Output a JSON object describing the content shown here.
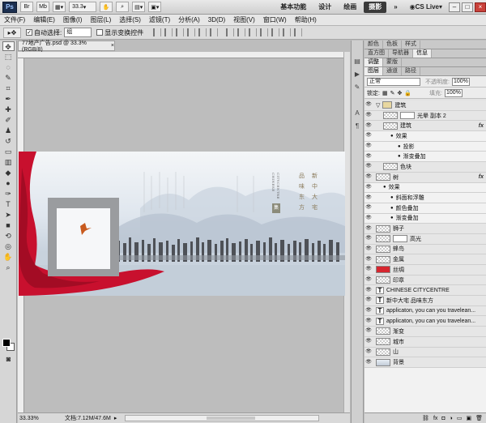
{
  "titlebar": {
    "app_logo": "Ps",
    "zoom": "33.3",
    "workspaces": [
      "基本功能",
      "设计",
      "绘画",
      "摄影"
    ],
    "active_workspace": "摄影",
    "cs_live": "CS Live"
  },
  "menu": [
    "文件(F)",
    "编辑(E)",
    "图像(I)",
    "图层(L)",
    "选择(S)",
    "滤镜(T)",
    "分析(A)",
    "3D(D)",
    "视图(V)",
    "窗口(W)",
    "帮助(H)"
  ],
  "options": {
    "auto_select_label": "自动选择:",
    "auto_select_value": "组",
    "show_transform_label": "显示变换控件"
  },
  "document": {
    "tab_title": "77地产广告.psd @ 33.3%(RGB/8)",
    "zoom": "33.33%",
    "doc_size": "文档:7.12M/47.6M"
  },
  "artwork_text": {
    "col1": [
      "新",
      "中",
      "大",
      "宅"
    ],
    "col2": [
      "品",
      "味",
      "东",
      "方"
    ],
    "en1": "CHINESE",
    "en2": "CITYCENTRE",
    "seal": "集"
  },
  "panels": {
    "top_tabs": [
      "颜色",
      "色板",
      "样式"
    ],
    "mid_tabs": [
      "直方图",
      "导航器",
      "信息"
    ],
    "adjust_tabs": [
      "调整",
      "蒙版"
    ],
    "layer_tabs": [
      "图层",
      "通道",
      "路径"
    ],
    "blend_mode": "正常",
    "opacity_label": "不透明度:",
    "opacity": "100%",
    "lock_label": "锁定:",
    "fill_label": "填充:",
    "fill": "100%"
  },
  "layers": [
    {
      "name": "建筑",
      "kind": "group",
      "indent": 0
    },
    {
      "name": "光晕 副本 2",
      "kind": "mask",
      "indent": 1
    },
    {
      "name": "建筑",
      "kind": "pixel",
      "indent": 1,
      "fx": true
    },
    {
      "name": "效果",
      "kind": "effect",
      "indent": 2
    },
    {
      "name": "投影",
      "kind": "effect",
      "indent": 3
    },
    {
      "name": "渐变叠加",
      "kind": "effect",
      "indent": 3
    },
    {
      "name": "色块",
      "kind": "pixel",
      "indent": 1
    },
    {
      "name": "树",
      "kind": "pixel",
      "indent": 0,
      "fx": true
    },
    {
      "name": "效果",
      "kind": "effect",
      "indent": 1
    },
    {
      "name": "斜面和浮雕",
      "kind": "effect",
      "indent": 2
    },
    {
      "name": "颜色叠加",
      "kind": "effect",
      "indent": 2
    },
    {
      "name": "渐变叠加",
      "kind": "effect",
      "indent": 2
    },
    {
      "name": "狮子",
      "kind": "pixel",
      "indent": 0
    },
    {
      "name": "高光",
      "kind": "mask",
      "indent": 0
    },
    {
      "name": "蜂鸟",
      "kind": "pixel",
      "indent": 0
    },
    {
      "name": "金属",
      "kind": "pixel",
      "indent": 0
    },
    {
      "name": "丝绸",
      "kind": "red",
      "indent": 0
    },
    {
      "name": "印章",
      "kind": "pixel",
      "indent": 0
    },
    {
      "name": "CHINESE       CITYCENTRE",
      "kind": "text",
      "indent": 0
    },
    {
      "name": "新中大宅 品味东方",
      "kind": "text",
      "indent": 0
    },
    {
      "name": "applicaton, you can you travelean...",
      "kind": "text",
      "indent": 0
    },
    {
      "name": "applicaton, you can you travelean...",
      "kind": "text",
      "indent": 0
    },
    {
      "name": "渐变",
      "kind": "pixel",
      "indent": 0
    },
    {
      "name": "城市",
      "kind": "pixel",
      "indent": 0
    },
    {
      "name": "山",
      "kind": "pixel",
      "indent": 0
    },
    {
      "name": "背景",
      "kind": "bg",
      "indent": 0
    }
  ],
  "colors": {
    "silk_red": "#c8102e",
    "accent_dark": "#3a3a3a",
    "foreground": "#000000",
    "background": "#ffffff"
  }
}
